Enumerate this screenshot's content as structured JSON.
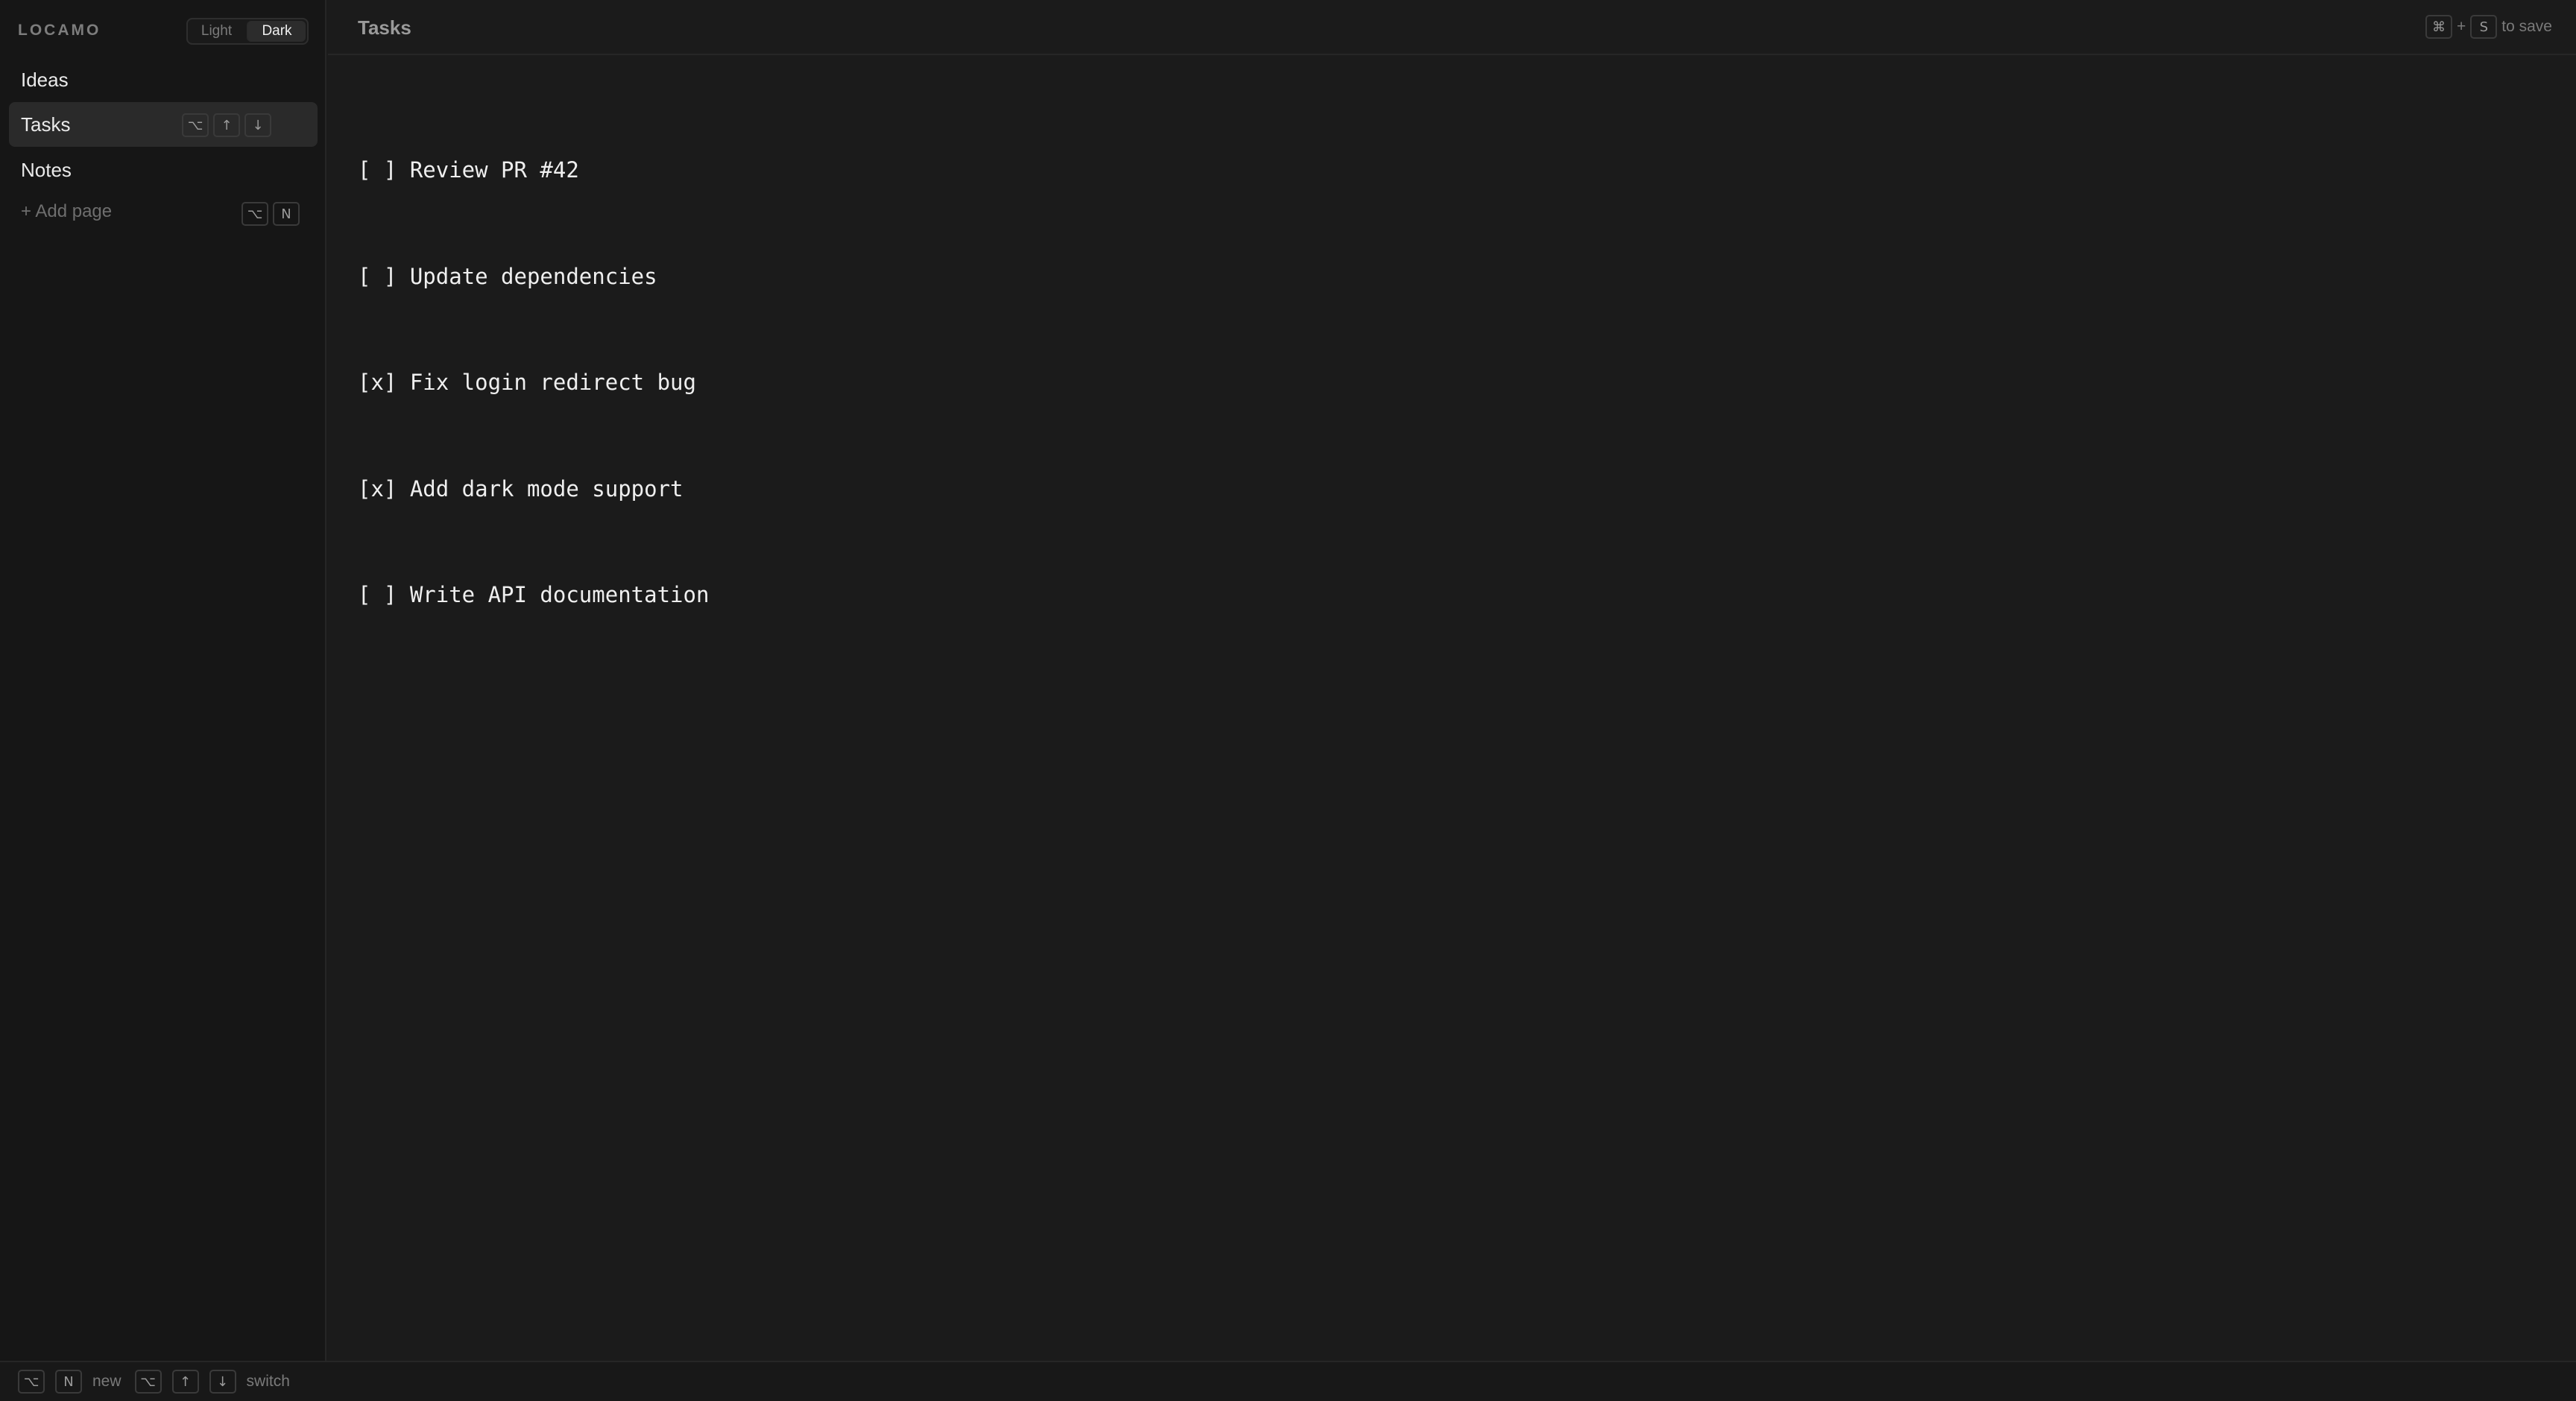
{
  "app": {
    "brand": "LOCAMO"
  },
  "theme_toggle": {
    "light_label": "Light",
    "dark_label": "Dark",
    "selected": "Dark"
  },
  "sidebar": {
    "items": [
      {
        "label": "Ideas"
      },
      {
        "label": "Tasks",
        "active": true
      },
      {
        "label": "Notes"
      }
    ],
    "active_item_keys": [
      "⌥",
      "↑",
      "↓"
    ],
    "add_page_label": "+ Add page",
    "add_page_keys": [
      "⌥",
      "N"
    ]
  },
  "header": {
    "title": "Tasks",
    "save_hint": {
      "keys": [
        "⌘",
        "S"
      ],
      "plus": "+",
      "text": "to save"
    }
  },
  "editor": {
    "lines": [
      "[ ] Review PR #42",
      "[ ] Update dependencies",
      "[x] Fix login redirect bug",
      "[x] Add dark mode support",
      "[ ] Write API documentation"
    ]
  },
  "footer": {
    "new_keys": [
      "⌥",
      "N"
    ],
    "new_label": "new",
    "switch_keys": [
      "⌥",
      "↑",
      "↓"
    ],
    "switch_label": "switch"
  },
  "colors": {
    "background": "#1b1b1b",
    "sidebar": "#161616",
    "active_item": "#2a2a2a",
    "text": "#efefef",
    "muted": "#7a7a7a"
  }
}
